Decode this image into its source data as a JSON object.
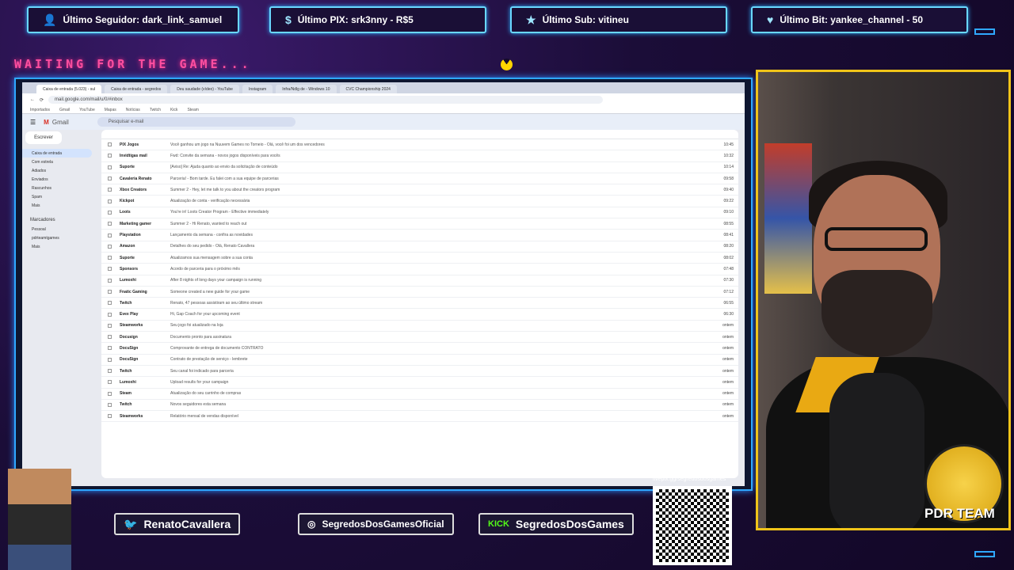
{
  "overlay": {
    "follower": "Último Seguidor: dark_link_samuel",
    "pix": "Último PIX: srk3nny - R$5",
    "sub": "Último Sub: vitineu",
    "bit": "Último Bit: yankee_channel - 50",
    "waiting": "WAITING FOR THE GAME...",
    "twitter": "RenatoCavallera",
    "instagram": "SegredosDosGamesOficial",
    "kick_label": "KICK",
    "kick": "SegredosDosGames",
    "qr_url": "livepix.gg/segredosdosgames",
    "team": "PDR TEAM"
  },
  "browser": {
    "tabs": [
      "Caixa de entrada (5.023) - sul",
      "Caixa de entrada - segredos",
      "Deu saudade (vídeo) - YouTube",
      "Instagram",
      "Infra/Ndlg de - Windows 10",
      "CVC Championship 2024"
    ],
    "url": "mail.google.com/mail/u/0/#inbox",
    "bookmarks": [
      "Importados",
      "Gmail",
      "YouTube",
      "Mapas",
      "Notícias",
      "Twitch",
      "Kick",
      "Steam"
    ],
    "gmail_label": "Gmail",
    "search_placeholder": "Pesquisar e-mail",
    "compose": "Escrever",
    "folders": [
      "Caixa de entrada",
      "Com estrela",
      "Adiados",
      "Enviados",
      "Rascunhos",
      "Spam",
      "Mais"
    ],
    "labels_title": "Marcadores",
    "labels": [
      "Pessoal",
      "pdrteamtgames",
      "Mais"
    ],
    "inbox_count": "5.023"
  },
  "emails": [
    {
      "sender": "PIX Jogos",
      "text": "Você ganhou um jogo na Nuuvem Games no Torneio - Olá, você foi um dos vencedores",
      "time": "10:45"
    },
    {
      "sender": "Invidtigas mail",
      "text": "Fwd: Convite da semana - novos jogos disponíveis para vocês",
      "time": "10:32"
    },
    {
      "sender": "Suporte",
      "text": "[Aviso] Re: Ajuda quanto ao envio da solicitação de conteúdo",
      "time": "10:14"
    },
    {
      "sender": "Cavaleria Renato",
      "text": "Parceria! - Bom tarde. Eu falei com a sua equipe de parcerias",
      "time": "09:58"
    },
    {
      "sender": "Xbox Creators",
      "text": "Summer 2 - Hey, let me talk to you about the creators program",
      "time": "09:40"
    },
    {
      "sender": "Kickpot",
      "text": "Atualização de conta - verificação necessária",
      "time": "09:22"
    },
    {
      "sender": "Loots",
      "text": "You're in! Loots Creator Program - Effective immediately",
      "time": "09:10"
    },
    {
      "sender": "Marketing gamer",
      "text": "Summer 2 - Hi Renato, wanted to reach out",
      "time": "08:55"
    },
    {
      "sender": "Playstation",
      "text": "Lançamento da semana - confira as novidades",
      "time": "08:41"
    },
    {
      "sender": "Amazon",
      "text": "Detalhes do seu pedido - Olá, Renato Cavallera",
      "time": "08:20"
    },
    {
      "sender": "Suporte",
      "text": "Atualizamos sua mensagem sobre a sua conta",
      "time": "08:02"
    },
    {
      "sender": "Sponsors",
      "text": "Acordo de parceria para o próximo mês",
      "time": "07:48"
    },
    {
      "sender": "Lumoxhi",
      "text": "After 8 nights of long days your campaign is running",
      "time": "07:30"
    },
    {
      "sender": "Fnatic Gaming",
      "text": "Someone created a new guide for your game",
      "time": "07:12"
    },
    {
      "sender": "Twitch",
      "text": "Renato, 47 pessoas assistiram ao seu último stream",
      "time": "06:55"
    },
    {
      "sender": "Evex Play",
      "text": "Hi, Gap Coach for your upcoming event",
      "time": "06:30"
    },
    {
      "sender": "Steamworks",
      "text": "Seu jogo foi atualizado na loja",
      "time": "ontem"
    },
    {
      "sender": "Docusign",
      "text": "Documento pronto para assinatura",
      "time": "ontem"
    },
    {
      "sender": "DocuSign",
      "text": "Comprovante de entrega de documento CONTRATO",
      "time": "ontem"
    },
    {
      "sender": "DocuSign",
      "text": "Contrato de prestação de serviço - lembrete",
      "time": "ontem"
    },
    {
      "sender": "Twitch",
      "text": "Seu canal foi indicado para parceria",
      "time": "ontem"
    },
    {
      "sender": "Lumoxhi",
      "text": "Upload results for your campaign",
      "time": "ontem"
    },
    {
      "sender": "Steam",
      "text": "Atualização do seu carrinho de compras",
      "time": "ontem"
    },
    {
      "sender": "Twitch",
      "text": "Novos seguidores esta semana",
      "time": "ontem"
    },
    {
      "sender": "Steamworks",
      "text": "Relatório mensal de vendas disponível",
      "time": "ontem"
    }
  ]
}
